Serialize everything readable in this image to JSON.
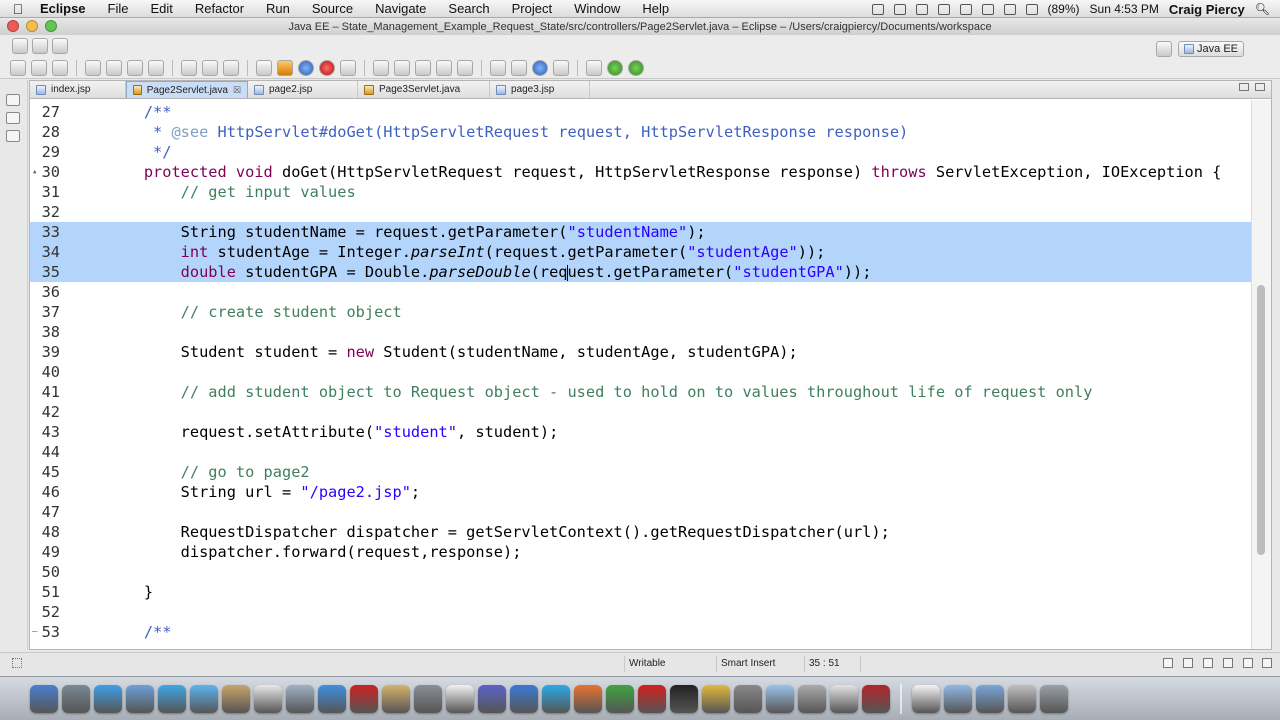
{
  "menubar": {
    "app": "Eclipse",
    "items": [
      "File",
      "Edit",
      "Refactor",
      "Run",
      "Source",
      "Navigate",
      "Search",
      "Project",
      "Window",
      "Help"
    ],
    "battery": "(89%)",
    "clock": "Sun 4:53 PM",
    "user": "Craig Piercy"
  },
  "window": {
    "title": "Java EE – State_Management_Example_Request_State/src/controllers/Page2Servlet.java – Eclipse – /Users/craigpiercy/Documents/workspace"
  },
  "perspective": {
    "label": "Java EE"
  },
  "tabs": [
    {
      "label": "index.jsp",
      "active": false,
      "icon": "jsp-file-icon"
    },
    {
      "label": "Page2Servlet.java",
      "active": true,
      "icon": "java-file-icon",
      "close": "☒"
    },
    {
      "label": "page2.jsp",
      "active": false,
      "icon": "jsp-file-icon"
    },
    {
      "label": "Page3Servlet.java",
      "active": false,
      "icon": "java-file-icon"
    },
    {
      "label": "page3.jsp",
      "active": false,
      "icon": "jsp-file-icon"
    }
  ],
  "code": {
    "selected_lines": [
      33,
      34,
      35
    ],
    "lines": [
      {
        "n": "27",
        "fold": "",
        "tokens": [
          [
            "",
            "    "
          ],
          [
            "jd",
            "/**"
          ]
        ]
      },
      {
        "n": "28",
        "fold": "",
        "tokens": [
          [
            "jd",
            "     * "
          ],
          [
            "jdtag",
            "@see"
          ],
          [
            "jd",
            " HttpServlet#doGet(HttpServletRequest request, HttpServletResponse response)"
          ]
        ]
      },
      {
        "n": "29",
        "fold": "",
        "tokens": [
          [
            "jd",
            "     */"
          ]
        ]
      },
      {
        "n": "30",
        "fold": "▴",
        "tokens": [
          [
            "kw",
            "    protected void"
          ],
          [
            "",
            " doGet(HttpServletRequest request, HttpServletResponse response) "
          ],
          [
            "kw",
            "throws"
          ],
          [
            "",
            " ServletException, IOException {"
          ]
        ]
      },
      {
        "n": "31",
        "fold": "",
        "tokens": [
          [
            "cm",
            "        // get input values"
          ]
        ]
      },
      {
        "n": "32",
        "fold": "",
        "tokens": [
          [
            "",
            ""
          ]
        ]
      },
      {
        "n": "33",
        "fold": "",
        "tokens": [
          [
            "",
            "        String studentName = request.getParameter("
          ],
          [
            "st",
            "\"studentName\""
          ],
          [
            "",
            ");"
          ]
        ]
      },
      {
        "n": "34",
        "fold": "",
        "tokens": [
          [
            "kw",
            "        int"
          ],
          [
            "",
            " studentAge = Integer."
          ],
          [
            "it",
            "parseInt"
          ],
          [
            "",
            "(request.getParameter("
          ],
          [
            "st",
            "\"studentAge\""
          ],
          [
            "",
            "));"
          ]
        ]
      },
      {
        "n": "35",
        "fold": "",
        "tokens": [
          [
            "kw",
            "        double"
          ],
          [
            "",
            " studentGPA = Double."
          ],
          [
            "it",
            "parseDouble"
          ],
          [
            "",
            "(req"
          ],
          [
            "cursor",
            ""
          ],
          [
            "",
            "uest.getParameter("
          ],
          [
            "st",
            "\"studentGPA\""
          ],
          [
            "",
            "));"
          ]
        ]
      },
      {
        "n": "36",
        "fold": "",
        "tokens": [
          [
            "",
            ""
          ]
        ]
      },
      {
        "n": "37",
        "fold": "",
        "tokens": [
          [
            "cm",
            "        // create student object"
          ]
        ]
      },
      {
        "n": "38",
        "fold": "",
        "tokens": [
          [
            "",
            ""
          ]
        ]
      },
      {
        "n": "39",
        "fold": "",
        "tokens": [
          [
            "",
            "        Student student = "
          ],
          [
            "kw",
            "new"
          ],
          [
            "",
            " Student(studentName, studentAge, studentGPA);"
          ]
        ]
      },
      {
        "n": "40",
        "fold": "",
        "tokens": [
          [
            "",
            ""
          ]
        ]
      },
      {
        "n": "41",
        "fold": "",
        "tokens": [
          [
            "cm",
            "        // add student object to Request object - used to hold on to values throughout life of request only"
          ]
        ]
      },
      {
        "n": "42",
        "fold": "",
        "tokens": [
          [
            "",
            ""
          ]
        ]
      },
      {
        "n": "43",
        "fold": "",
        "tokens": [
          [
            "",
            "        request.setAttribute("
          ],
          [
            "st",
            "\"student\""
          ],
          [
            "",
            ", student);"
          ]
        ]
      },
      {
        "n": "44",
        "fold": "",
        "tokens": [
          [
            "",
            ""
          ]
        ]
      },
      {
        "n": "45",
        "fold": "",
        "tokens": [
          [
            "cm",
            "        // go to page2"
          ]
        ]
      },
      {
        "n": "46",
        "fold": "",
        "tokens": [
          [
            "",
            "        String url = "
          ],
          [
            "st",
            "\"/page2.jsp\""
          ],
          [
            "",
            ";"
          ]
        ]
      },
      {
        "n": "47",
        "fold": "",
        "tokens": [
          [
            "",
            ""
          ]
        ]
      },
      {
        "n": "48",
        "fold": "",
        "tokens": [
          [
            "",
            "        RequestDispatcher dispatcher = getServletContext().getRequestDispatcher(url);"
          ]
        ]
      },
      {
        "n": "49",
        "fold": "",
        "tokens": [
          [
            "",
            "        dispatcher.forward(request,response);"
          ]
        ]
      },
      {
        "n": "50",
        "fold": "",
        "tokens": [
          [
            "",
            ""
          ]
        ]
      },
      {
        "n": "51",
        "fold": "",
        "tokens": [
          [
            "",
            "    }"
          ]
        ]
      },
      {
        "n": "52",
        "fold": "",
        "tokens": [
          [
            "",
            ""
          ]
        ]
      },
      {
        "n": "53",
        "fold": "–",
        "tokens": [
          [
            "jd",
            "    /**"
          ]
        ]
      }
    ]
  },
  "statusbar": {
    "writable": "Writable",
    "insert_mode": "Smart Insert",
    "position": "35 : 51"
  },
  "colors": {
    "keyword": "#7f0055",
    "comment": "#3f7f5f",
    "javadoc": "#3f5fbf",
    "string": "#2a00ff",
    "selection": "#b3d4fb"
  },
  "dock": {
    "icons": [
      "finder-icon",
      "launchpad-icon",
      "app-store-icon",
      "preview-icon",
      "safari-icon",
      "messages-icon",
      "contacts-icon",
      "calendar-icon",
      "photo-icon",
      "itunes-icon",
      "photo-booth-icon",
      "iphoto-icon",
      "system-prefs-icon",
      "box-icon",
      "java-ee-icon",
      "xcode-icon",
      "skype-icon",
      "firefox-icon",
      "chrome-icon",
      "opera-icon",
      "terminal-icon",
      "cyberduck-icon",
      "disk-utility-icon",
      "folder-icon",
      "hardware-icon",
      "bulb-icon",
      "filezilla-icon",
      "docs-icon",
      "applications-folder-icon",
      "downloads-folder-icon",
      "pictures-icon",
      "trash-icon"
    ]
  }
}
